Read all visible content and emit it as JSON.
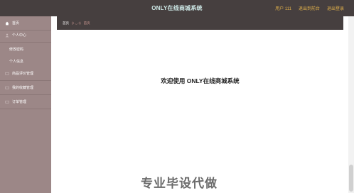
{
  "header": {
    "title": "ONLY在线商城系统",
    "user": "用户 111",
    "links": [
      "退出到前台",
      "退出登录"
    ]
  },
  "sidebar": {
    "items": [
      {
        "label": "首页",
        "icon": "home-icon",
        "type": "main"
      },
      {
        "label": "个人中心",
        "icon": "user-icon",
        "type": "main"
      },
      {
        "label": "修改密码",
        "icon": "",
        "type": "sub"
      },
      {
        "label": "个人信息",
        "icon": "",
        "type": "sub"
      },
      {
        "label": "商品评价管理",
        "icon": "comment-icon",
        "type": "main"
      },
      {
        "label": "我的收藏管理",
        "icon": "star-icon",
        "type": "main"
      },
      {
        "label": "订单管理",
        "icon": "order-icon",
        "type": "main"
      }
    ]
  },
  "breadcrumb": {
    "home": "首页",
    "separator": "(• ◡ •)",
    "current": "首页"
  },
  "main": {
    "welcome": "欢迎使用 ONLY在线商城系统"
  },
  "watermark": "专业毕设代做",
  "colors": {
    "topbar": "#463f3f",
    "sidebar": "#9c8787",
    "title": "#cfeae8",
    "accent": "#e2b14a"
  }
}
